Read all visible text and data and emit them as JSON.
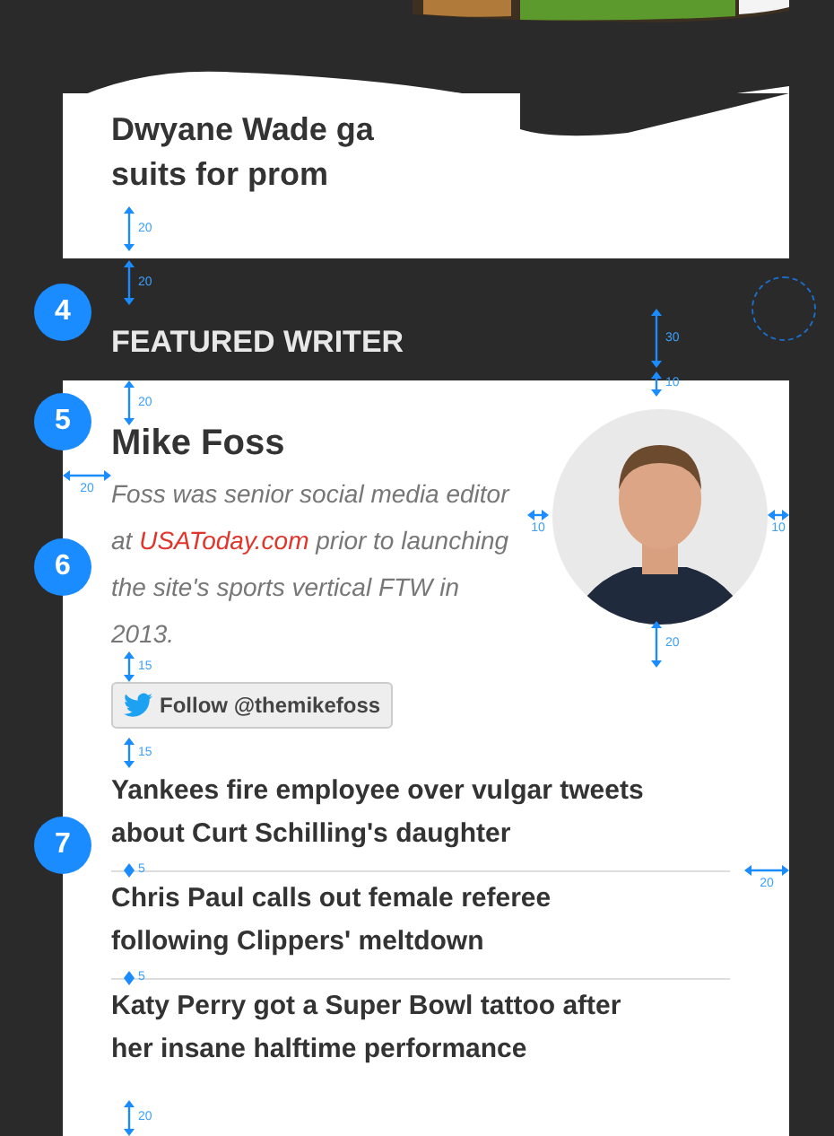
{
  "top_image": {
    "kind": "picture"
  },
  "story_card": {
    "headline_lines": [
      "Dwyane Wade ga",
      "suits for prom"
    ]
  },
  "section_title": "FEATURED WRITER",
  "writer": {
    "name": "Mike Foss",
    "bio_before": "Foss was senior social media editor at",
    "bio_link": "USAToday.com",
    "bio_after": "prior to launching the site's sports vertical FTW in 2013.",
    "avatar": {
      "kind": "picture"
    },
    "follow_button": "Follow @themikefoss"
  },
  "headlines": [
    "Yankees fire employee over vulgar tweets about Curt Schilling's daughter",
    "Chris Paul calls out female referee following Clippers' meltdown",
    "Katy Perry got a Super Bowl tattoo after her insane halftime performance"
  ],
  "callouts": [
    "4",
    "5",
    "6",
    "7"
  ],
  "annotations": [
    {
      "kind": "vertical",
      "value": "20"
    },
    {
      "kind": "vertical",
      "value": "20"
    },
    {
      "kind": "vertical",
      "value": "30"
    },
    {
      "kind": "vertical",
      "value": "10"
    },
    {
      "kind": "vertical",
      "value": "20"
    },
    {
      "kind": "horizontal",
      "value": "20"
    },
    {
      "kind": "horizontal",
      "value": "10"
    },
    {
      "kind": "horizontal",
      "value": "10"
    },
    {
      "kind": "vertical",
      "value": "20"
    },
    {
      "kind": "vertical",
      "value": "15"
    },
    {
      "kind": "vertical",
      "value": "15"
    },
    {
      "kind": "horizontal",
      "value": "20"
    },
    {
      "kind": "vertical",
      "value": "5"
    },
    {
      "kind": "vertical",
      "value": "5"
    },
    {
      "kind": "vertical",
      "value": "20"
    }
  ]
}
